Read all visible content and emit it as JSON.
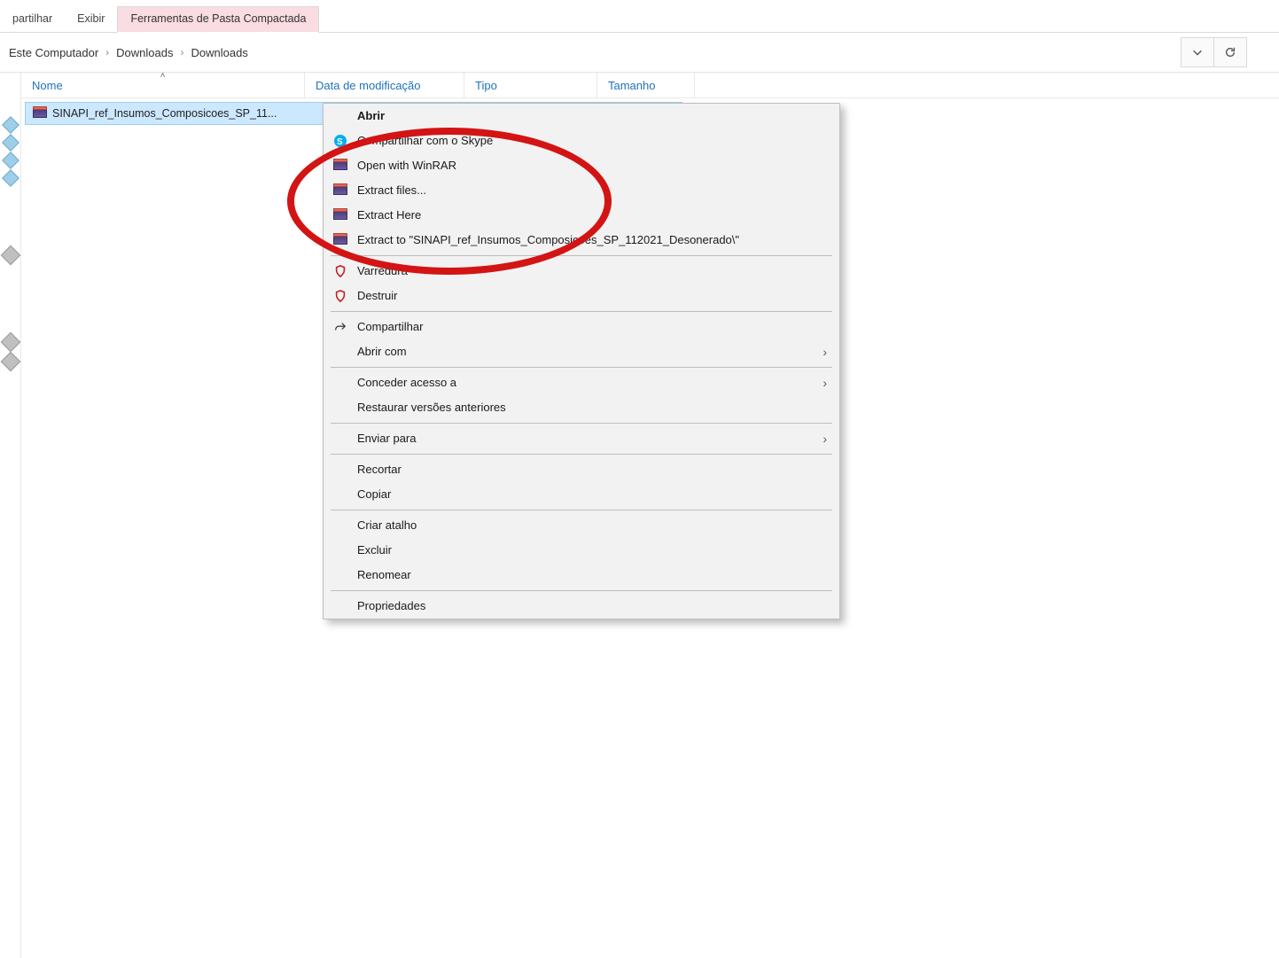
{
  "ribbon": {
    "tabs": [
      "partilhar",
      "Exibir",
      "Ferramentas de Pasta Compactada"
    ],
    "activeIndex": 2
  },
  "breadcrumb": {
    "items": [
      "Este Computador",
      "Downloads",
      "Downloads"
    ]
  },
  "columns": {
    "name": "Nome",
    "date": "Data de modificação",
    "type": "Tipo",
    "size": "Tamanho"
  },
  "file": {
    "name": "SINAPI_ref_Insumos_Composicoes_SP_11..."
  },
  "ctx": {
    "open": "Abrir",
    "skype": "Compartilhar com o Skype",
    "openWinrar": "Open with WinRAR",
    "extractFiles": "Extract files...",
    "extractHere": "Extract Here",
    "extractTo": "Extract to \"SINAPI_ref_Insumos_Composicoes_SP_112021_Desonerado\\\"",
    "varredura": "Varredura",
    "destruir": "Destruir",
    "compartilhar": "Compartilhar",
    "abrirCom": "Abrir com",
    "conceder": "Conceder acesso a",
    "restaurar": "Restaurar versões anteriores",
    "enviar": "Enviar para",
    "recortar": "Recortar",
    "copiar": "Copiar",
    "atalho": "Criar atalho",
    "excluir": "Excluir",
    "renomear": "Renomear",
    "propriedades": "Propriedades"
  }
}
